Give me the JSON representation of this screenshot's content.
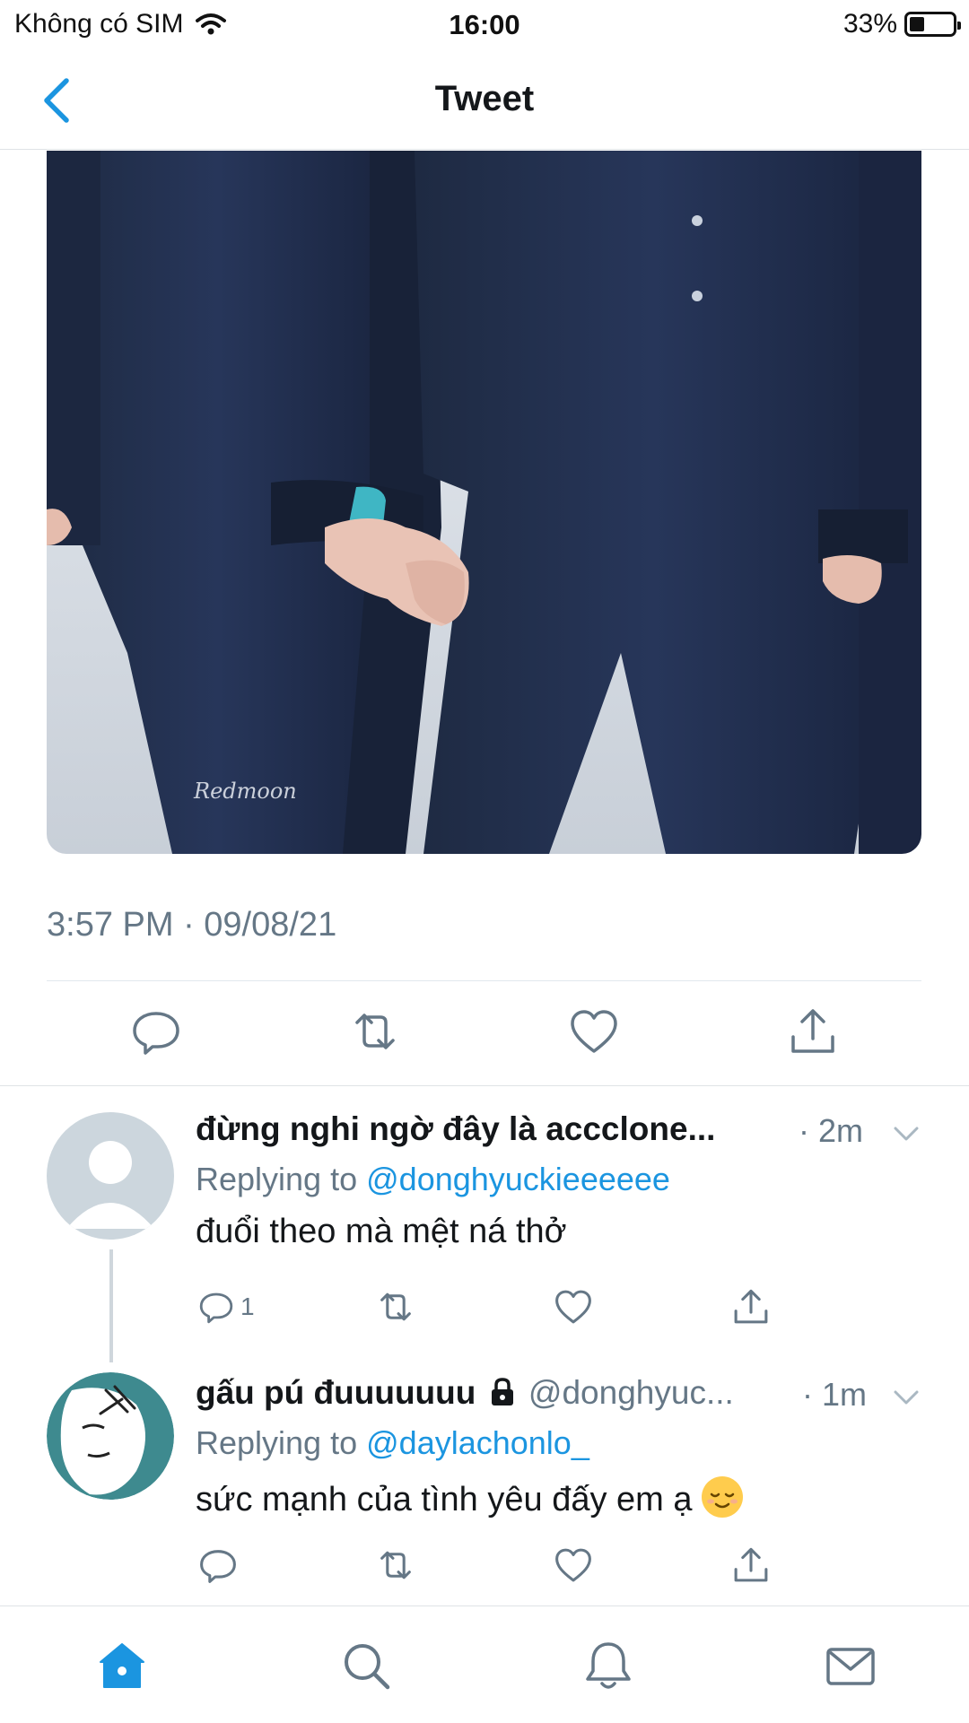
{
  "status_bar": {
    "carrier": "Không có SIM",
    "time": "16:00",
    "battery": "33%"
  },
  "nav": {
    "title": "Tweet"
  },
  "tweet": {
    "image_watermark": "Redmoon",
    "timestamp": "3:57 PM · 09/08/21"
  },
  "replies": [
    {
      "name": "đừng nghi ngờ đây là accclone...",
      "handle": "",
      "time": "· 2m",
      "replying_prefix": "Replying to",
      "replying_to": "@donghyuckieeeeee",
      "text": "đuổi theo mà mệt ná thở",
      "reply_count": "1"
    },
    {
      "name": "gấu pú đuuuuuuu",
      "handle": "@donghyuc...",
      "time": "· 1m",
      "replying_prefix": "Replying to",
      "replying_to": "@daylachonlo_",
      "text": "sức mạnh của tình yêu đấy em ạ",
      "reply_count": ""
    }
  ],
  "colors": {
    "accent": "#1b95e0",
    "muted": "#657786",
    "divider": "#e1e8ed"
  },
  "icons": {
    "tabs": [
      "home-icon",
      "search-icon",
      "notifications-icon",
      "messages-icon"
    ],
    "actions": [
      "reply-icon",
      "retweet-icon",
      "like-icon",
      "share-icon"
    ]
  }
}
